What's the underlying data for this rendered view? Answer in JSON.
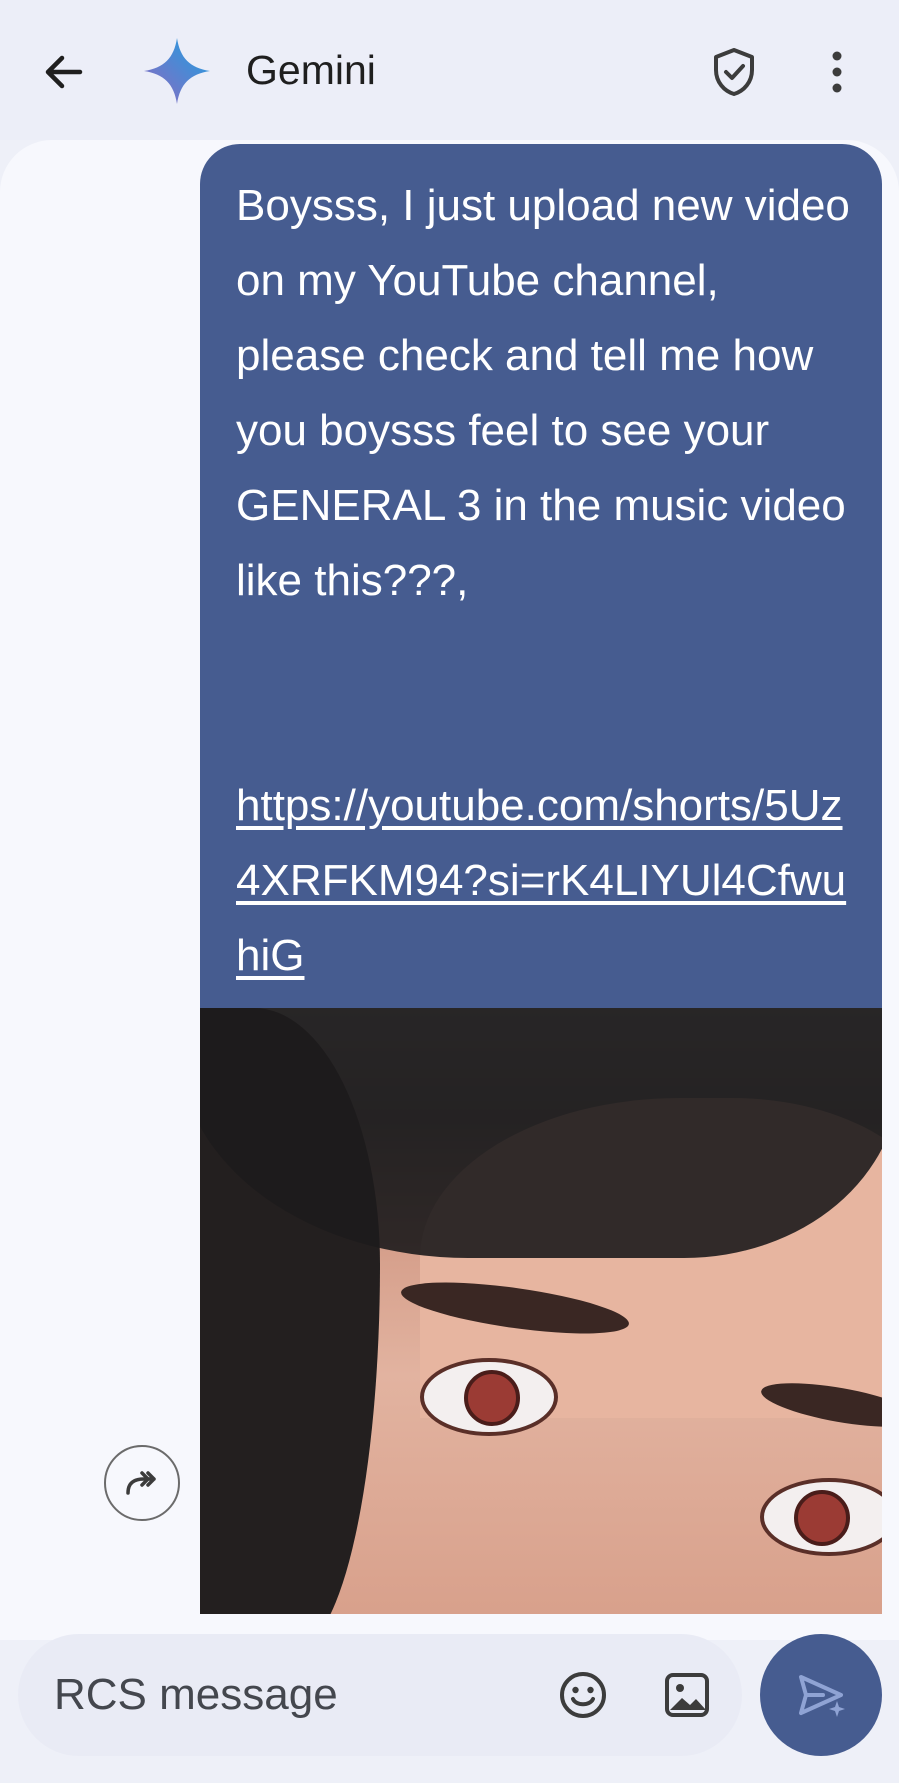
{
  "header": {
    "title": "Gemini",
    "icons": {
      "back": "arrow-back-icon",
      "logo": "gemini-sparkle-icon",
      "shield": "shield-check-icon",
      "more": "more-vert-icon"
    }
  },
  "message": {
    "text": "Boysss, I just upload new video on my YouTube channel, please check and tell me how you boysss feel to see your GENERAL 3 in the music video like this???,",
    "link": "https://youtube.com/shorts/5Uz4XRFKM94?si=rK4LIYUl4CfwuhiG",
    "bubble_color": "#465c90"
  },
  "actions": {
    "forward_icon": "forward-icon",
    "scroll_down_icon": "arrow-down-icon"
  },
  "composer": {
    "placeholder": "RCS message",
    "emoji_icon": "emoji-icon",
    "image_icon": "image-icon",
    "send_icon": "send-icon"
  },
  "colors": {
    "accent": "#465c90",
    "background": "#eef0f8"
  }
}
